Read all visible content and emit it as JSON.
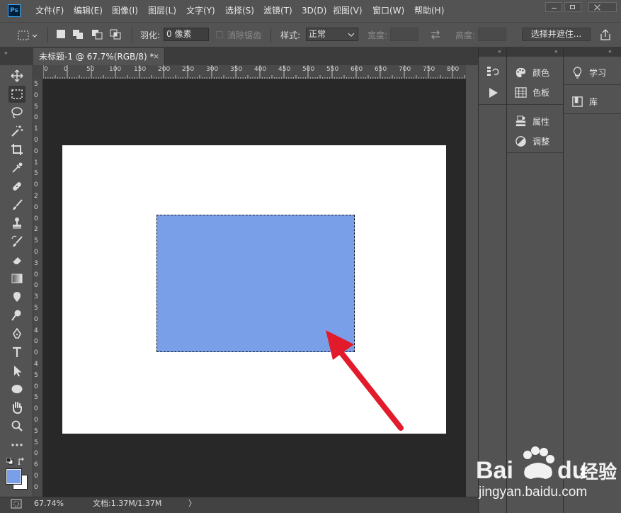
{
  "app": {
    "logo_text": "Ps"
  },
  "menu": [
    "文件(F)",
    "编辑(E)",
    "图像(I)",
    "图层(L)",
    "文字(Y)",
    "选择(S)",
    "滤镜(T)",
    "3D(D)",
    "视图(V)",
    "窗口(W)",
    "帮助(H)"
  ],
  "options": {
    "feather_label": "羽化:",
    "feather_value": "0 像素",
    "antialias_label": "消除锯齿",
    "style_label": "样式:",
    "style_value": "正常",
    "width_label": "宽度:",
    "height_label": "高度:",
    "select_mask_label": "选择并遮住..."
  },
  "document": {
    "tab_title": "未标题-1 @ 67.7%(RGB/8) *",
    "tab_close": "×"
  },
  "ruler": {
    "h_labels": [
      "0",
      "0",
      "50",
      "100",
      "150",
      "200",
      "250",
      "300",
      "350",
      "400",
      "450",
      "500",
      "550",
      "600",
      "650",
      "700",
      "750",
      "800"
    ],
    "v_labels": [
      "5",
      "0",
      "5",
      "0",
      "1",
      "0",
      "0",
      "1",
      "5",
      "0",
      "2",
      "0",
      "0",
      "2",
      "5",
      "0",
      "3",
      "0",
      "0",
      "3",
      "5",
      "0",
      "4",
      "0",
      "0",
      "4",
      "5",
      "0",
      "5",
      "0",
      "0",
      "5",
      "5",
      "0",
      "6",
      "0",
      "0"
    ]
  },
  "status": {
    "zoom": "67.74%",
    "doc_info": "文档:1.37M/1.37M",
    "arrow": "〉"
  },
  "panels": {
    "col2": [
      {
        "icon": "palette-icon",
        "label": "颜色"
      },
      {
        "icon": "swatches-icon",
        "label": "色板"
      },
      {
        "icon": "properties-icon",
        "label": "属性"
      },
      {
        "icon": "adjustments-icon",
        "label": "调整"
      }
    ],
    "col3": [
      {
        "icon": "lightbulb-icon",
        "label": "学习"
      },
      {
        "icon": "library-icon",
        "label": "库"
      }
    ]
  },
  "colors": {
    "selection_fill": "#7a9fe9",
    "foreground_color": "#7a9fe9",
    "background_color": "#ffffff",
    "annotation_arrow": "#e21b2c"
  },
  "watermark": {
    "brand": "Bai",
    "brand2": "du",
    "brand_cn": "经验",
    "url": "jingyan.baidu.com"
  }
}
